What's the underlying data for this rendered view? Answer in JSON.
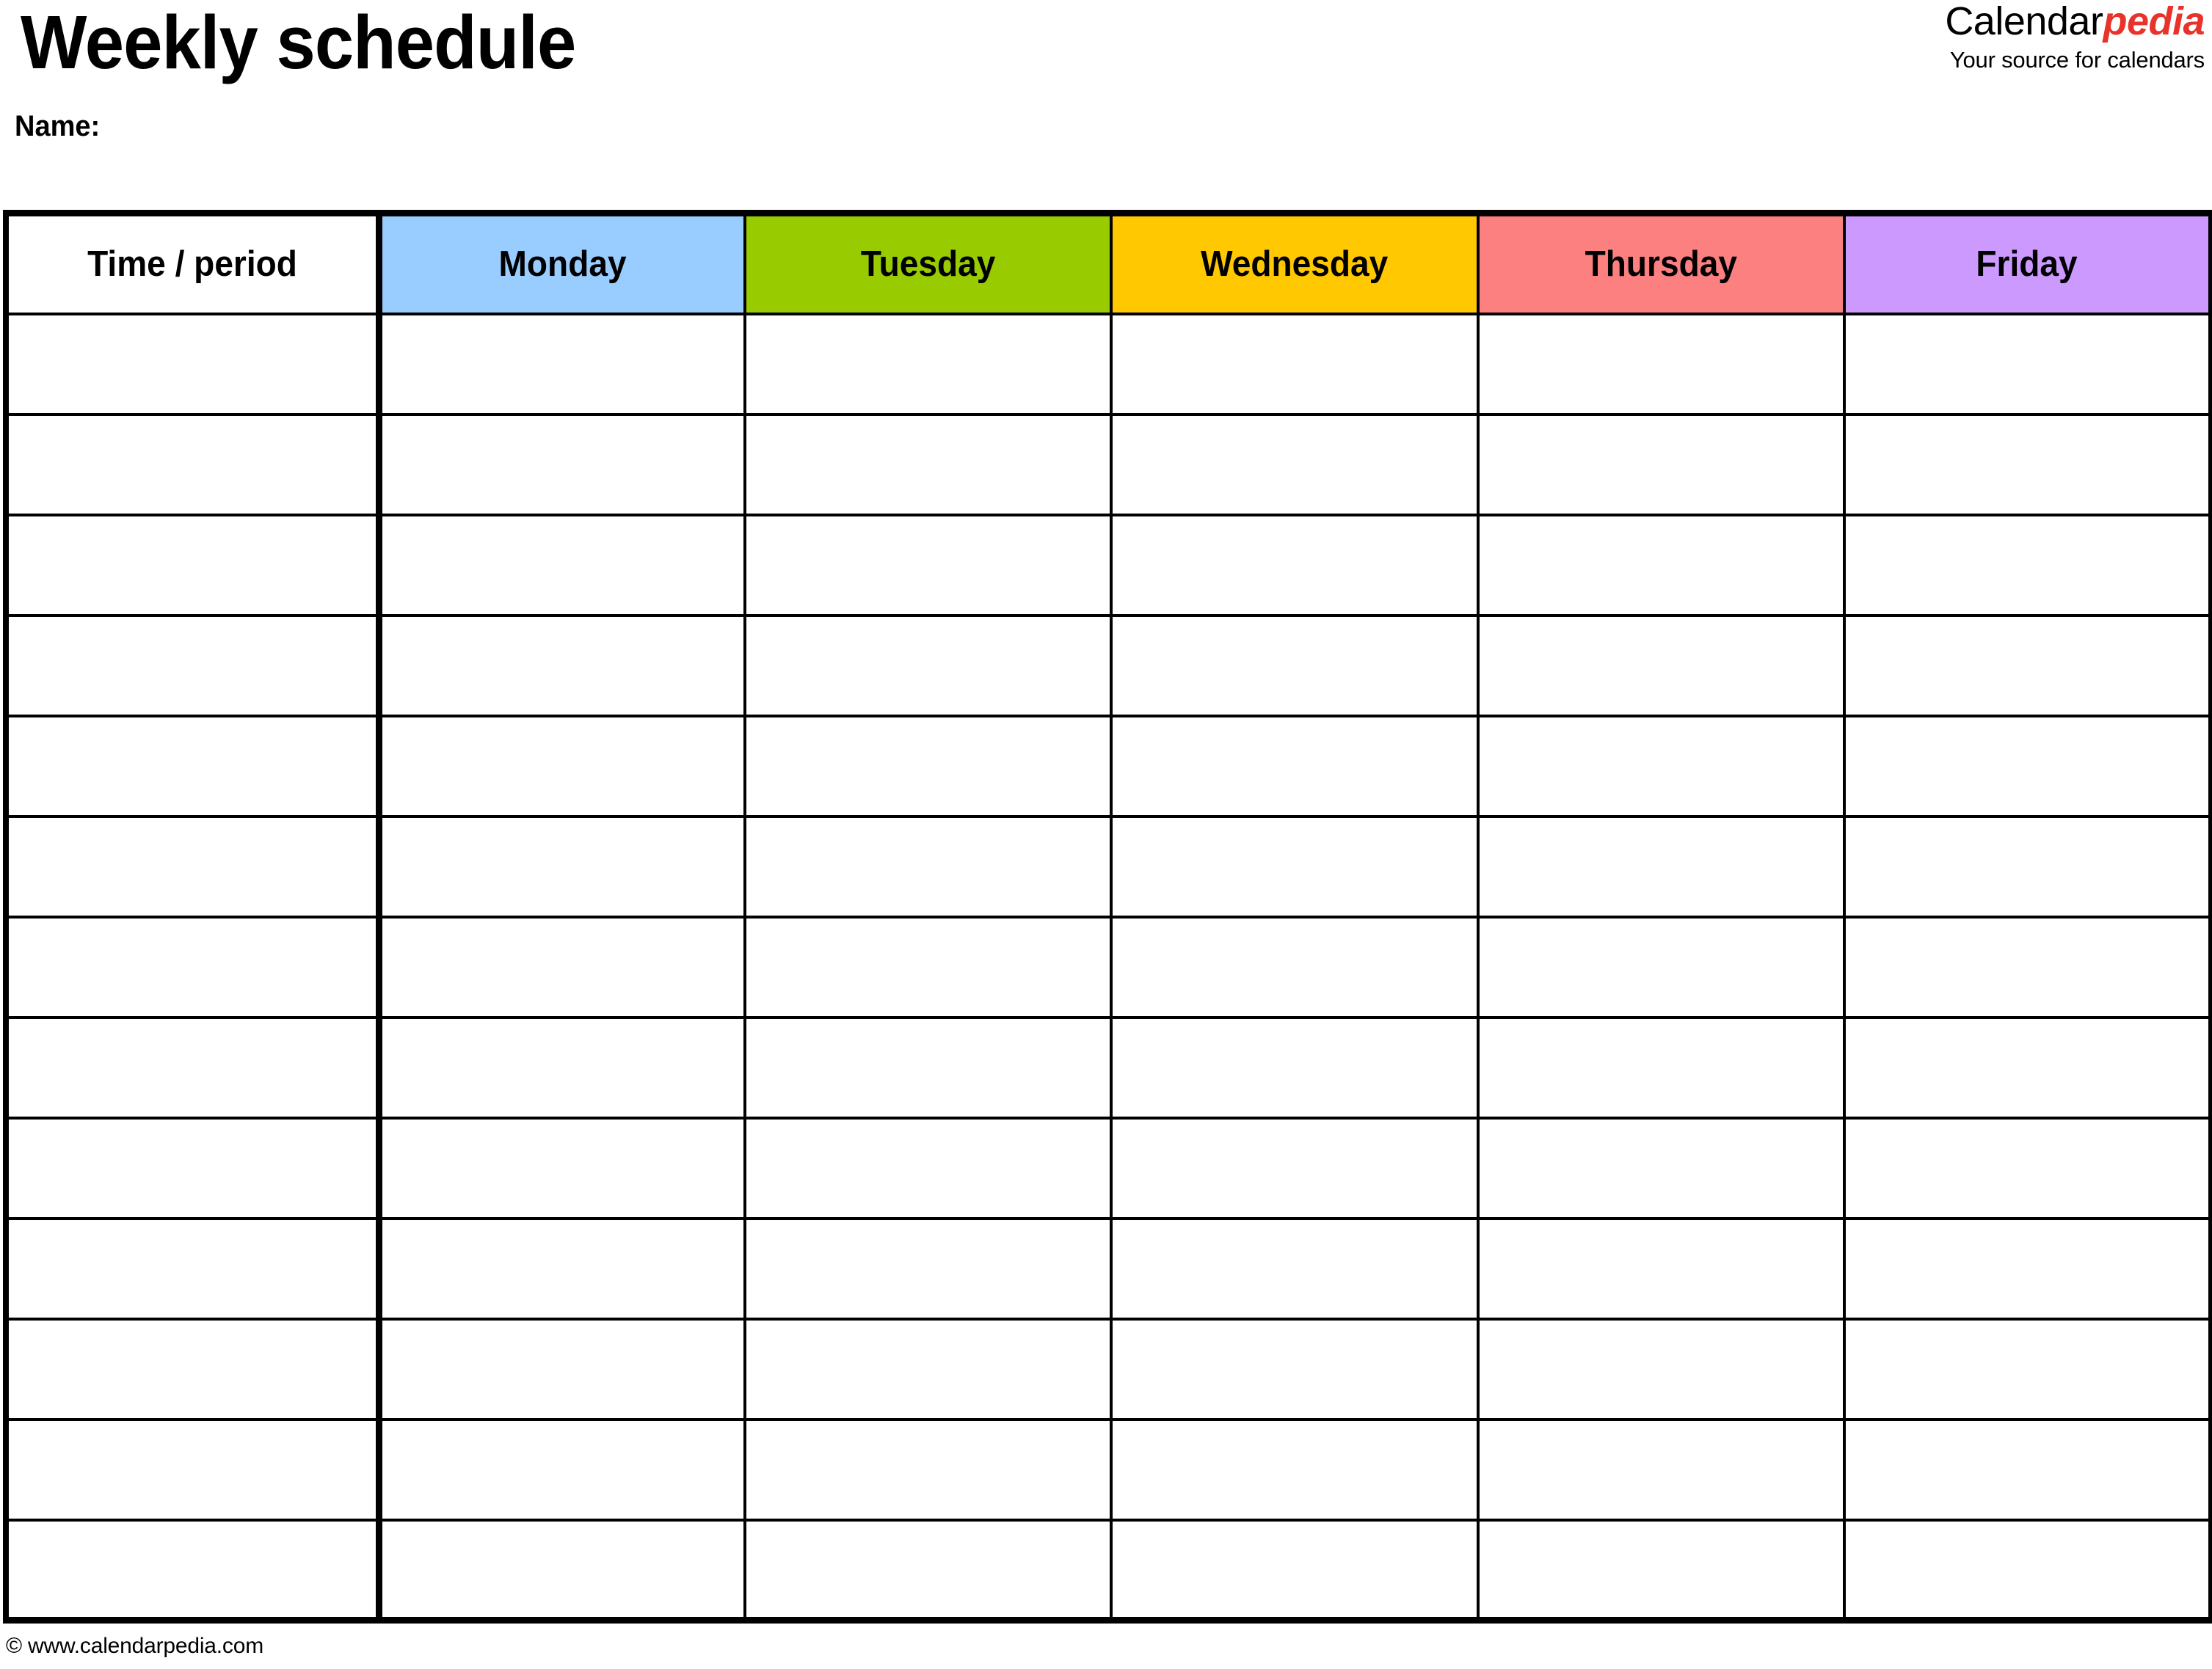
{
  "document": {
    "title": "Weekly schedule",
    "name_label": "Name:"
  },
  "logo": {
    "brand_part1": "Calendar",
    "brand_part2": "pedia",
    "tagline": "Your source for calendars",
    "brand_part1_color": "#000000",
    "brand_part2_color": "#e8332a"
  },
  "table": {
    "columns": [
      {
        "label": "Time / period",
        "color": "#ffffff",
        "key": "time"
      },
      {
        "label": "Monday",
        "color": "#99ccff",
        "key": "monday"
      },
      {
        "label": "Tuesday",
        "color": "#99cc00",
        "key": "tuesday"
      },
      {
        "label": "Wednesday",
        "color": "#ffc800",
        "key": "wednesday"
      },
      {
        "label": "Thursday",
        "color": "#fc8080",
        "key": "thursday"
      },
      {
        "label": "Friday",
        "color": "#cc99ff",
        "key": "friday"
      }
    ],
    "row_count": 13,
    "rows": [
      {
        "time": "",
        "monday": "",
        "tuesday": "",
        "wednesday": "",
        "thursday": "",
        "friday": ""
      },
      {
        "time": "",
        "monday": "",
        "tuesday": "",
        "wednesday": "",
        "thursday": "",
        "friday": ""
      },
      {
        "time": "",
        "monday": "",
        "tuesday": "",
        "wednesday": "",
        "thursday": "",
        "friday": ""
      },
      {
        "time": "",
        "monday": "",
        "tuesday": "",
        "wednesday": "",
        "thursday": "",
        "friday": ""
      },
      {
        "time": "",
        "monday": "",
        "tuesday": "",
        "wednesday": "",
        "thursday": "",
        "friday": ""
      },
      {
        "time": "",
        "monday": "",
        "tuesday": "",
        "wednesday": "",
        "thursday": "",
        "friday": ""
      },
      {
        "time": "",
        "monday": "",
        "tuesday": "",
        "wednesday": "",
        "thursday": "",
        "friday": ""
      },
      {
        "time": "",
        "monday": "",
        "tuesday": "",
        "wednesday": "",
        "thursday": "",
        "friday": ""
      },
      {
        "time": "",
        "monday": "",
        "tuesday": "",
        "wednesday": "",
        "thursday": "",
        "friday": ""
      },
      {
        "time": "",
        "monday": "",
        "tuesday": "",
        "wednesday": "",
        "thursday": "",
        "friday": ""
      },
      {
        "time": "",
        "monday": "",
        "tuesday": "",
        "wednesday": "",
        "thursday": "",
        "friday": ""
      },
      {
        "time": "",
        "monday": "",
        "tuesday": "",
        "wednesday": "",
        "thursday": "",
        "friday": ""
      },
      {
        "time": "",
        "monday": "",
        "tuesday": "",
        "wednesday": "",
        "thursday": "",
        "friday": ""
      }
    ]
  },
  "footer": {
    "copyright": "© www.calendarpedia.com"
  }
}
